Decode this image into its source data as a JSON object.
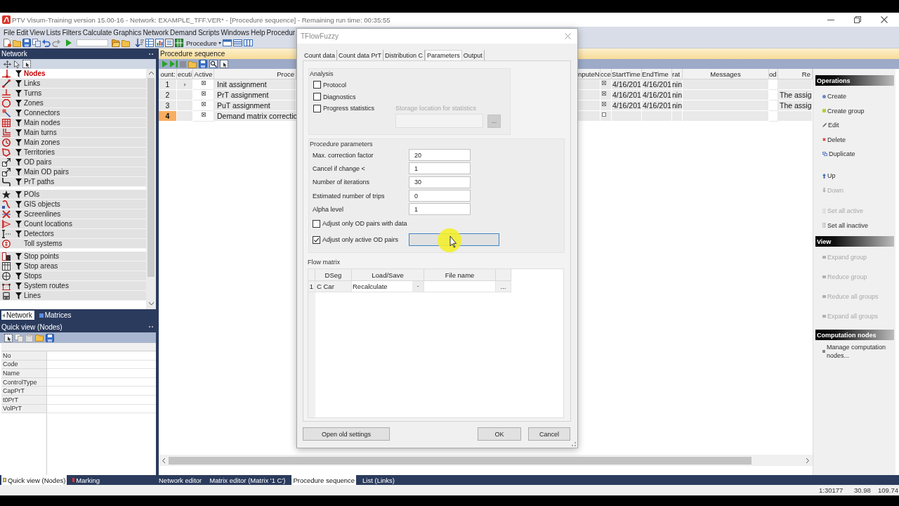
{
  "window": {
    "title": "PTV Visum-Training version 15.00-16 - Network: EXAMPLE_TFF.VER* - [Procedure sequence] - Remaining run time: 00:35:55"
  },
  "menu": [
    "File",
    "Edit",
    "View",
    "Lists",
    "Filters",
    "Calculate",
    "Graphics",
    "Network",
    "Demand",
    "Scripts",
    "Windows",
    "Help",
    "Procedur"
  ],
  "toolbar": {
    "dropdown": "Procedure"
  },
  "network_panel": {
    "title": "Network",
    "groups": [
      [
        {
          "label": "Nodes",
          "selected": true,
          "filter": true
        },
        {
          "label": "Links",
          "selected": false,
          "filter": true
        },
        {
          "label": "Turns",
          "selected": false,
          "filter": true
        },
        {
          "label": "Zones",
          "selected": false,
          "filter": true
        },
        {
          "label": "Connectors",
          "selected": false,
          "filter": true
        },
        {
          "label": "Main nodes",
          "selected": false,
          "filter": true
        },
        {
          "label": "Main turns",
          "selected": false,
          "filter": true
        },
        {
          "label": "Main zones",
          "selected": false,
          "filter": true
        },
        {
          "label": "Territories",
          "selected": false,
          "filter": true
        },
        {
          "label": "OD pairs",
          "selected": false,
          "filter": true
        },
        {
          "label": "Main OD pairs",
          "selected": false,
          "filter": true
        },
        {
          "label": "PrT paths",
          "selected": false,
          "filter": true
        }
      ],
      [
        {
          "label": "POIs",
          "selected": false,
          "filter": true
        },
        {
          "label": "GIS objects",
          "selected": false,
          "filter": true
        },
        {
          "label": "Screenlines",
          "selected": false,
          "filter": true
        },
        {
          "label": "Count locations",
          "selected": false,
          "filter": true
        },
        {
          "label": "Detectors",
          "selected": false,
          "filter": true
        },
        {
          "label": "Toll systems",
          "selected": false,
          "filter": false
        }
      ],
      [
        {
          "label": "Stop points",
          "selected": false,
          "filter": true
        },
        {
          "label": "Stop areas",
          "selected": false,
          "filter": true
        },
        {
          "label": "Stops",
          "selected": false,
          "filter": true
        },
        {
          "label": "System routes",
          "selected": false,
          "filter": true
        },
        {
          "label": "Lines",
          "selected": false,
          "filter": true
        }
      ]
    ]
  },
  "left_tabs": [
    {
      "label": "Network",
      "selected": true
    },
    {
      "label": "Matrices",
      "selected": false
    }
  ],
  "quick_view": {
    "title": "Quick view (Nodes)",
    "rows": [
      "No",
      "Code",
      "Name",
      "ControlType",
      "CapPrT",
      "t0PrT",
      "VolPrT"
    ]
  },
  "procedure_sequence": {
    "title": "Procedure sequence",
    "columns": [
      "ount:",
      "ecuti",
      "Active",
      "Proce",
      "nputeN",
      "cce",
      "StartTime",
      "EndTime",
      "rat",
      "Messages",
      "od",
      "Re"
    ],
    "rows": [
      {
        "column_1": "1",
        "selected": false,
        "current": true,
        "active": true,
        "column_4": "Init assignment",
        "column_6": true,
        "start_time": "4/16/201",
        "end_time": "4/16/201",
        "column_9": "nin"
      },
      {
        "column_1": "2",
        "selected": false,
        "current": false,
        "active": true,
        "column_4": "PrT assignment",
        "column_6": true,
        "start_time": "4/16/201",
        "end_time": "4/16/201",
        "column_9": "nin",
        "column_12": "The assig"
      },
      {
        "column_1": "3",
        "selected": false,
        "current": false,
        "active": true,
        "column_4": "PuT assignment",
        "column_6": true,
        "start_time": "4/16/201",
        "end_time": "4/16/201",
        "column_9": "nin",
        "column_12": "The assig"
      },
      {
        "column_1": "4",
        "selected": true,
        "current": false,
        "active": true,
        "column_4": "Demand matrix correctio",
        "column_6": false
      }
    ]
  },
  "operations": {
    "sections": [
      {
        "title": "Operations",
        "groups": [
          [
            {
              "label": "Create",
              "disabled": false
            },
            {
              "label": "Create group",
              "disabled": false
            },
            {
              "label": "Edit",
              "disabled": false
            },
            {
              "label": "Delete",
              "disabled": false
            },
            {
              "label": "Duplicate",
              "disabled": false
            }
          ],
          [
            {
              "label": "Up",
              "disabled": false
            },
            {
              "label": "Down",
              "disabled": true
            }
          ],
          [
            {
              "label": "Set all active",
              "disabled": true
            },
            {
              "label": "Set all inactive",
              "disabled": false
            }
          ]
        ]
      },
      {
        "title": "View",
        "groups": [
          [
            {
              "label": "Expand group",
              "disabled": true
            },
            {
              "label": "Reduce group",
              "disabled": true
            },
            {
              "label": "Reduce all groups",
              "disabled": true
            },
            {
              "label": "Expand all groups",
              "disabled": true
            }
          ]
        ]
      },
      {
        "title": "Computation nodes",
        "groups": [
          [
            {
              "label": "Manage computation nodes...",
              "disabled": false
            }
          ]
        ]
      }
    ]
  },
  "dialog": {
    "title": "TFlowFuzzy",
    "tabs": [
      {
        "label": "Count data",
        "selected": false
      },
      {
        "label": "Count data PrT",
        "selected": false
      },
      {
        "label": "Distribution C",
        "selected": false
      },
      {
        "label": "Parameters",
        "selected": true
      },
      {
        "label": "Output",
        "selected": false
      }
    ],
    "analysis": {
      "title": "Analysis",
      "options": [
        {
          "label": "Protocol",
          "checked": false
        },
        {
          "label": "Diagnostics",
          "checked": false
        },
        {
          "label": "Progress statistics",
          "checked": false
        }
      ],
      "storage": {
        "label": "Storage location for statistics",
        "disabled": true,
        "button": "..."
      }
    },
    "parameters": {
      "title": "Procedure parameters",
      "fields": [
        {
          "label": "Max. correction factor",
          "value": "20"
        },
        {
          "label": "Cancel if change <",
          "value": "1"
        },
        {
          "label": "Number of iterations",
          "value": "30"
        },
        {
          "label": "Estimated number of trips",
          "value": "0"
        },
        {
          "label": "Alpha level",
          "value": "1"
        }
      ],
      "options": [
        {
          "label": "Adjust only OD pairs with data",
          "checked": false
        },
        {
          "label": "Adjust only active OD pairs",
          "checked": true
        }
      ]
    },
    "flow_matrix": {
      "title": "Flow matrix",
      "columns": [
        "DSeg",
        "Load/Save",
        "File name"
      ],
      "rows": [
        {
          "number": "1",
          "dseg": "C Car",
          "load_save": "Recalculate",
          "button": "..."
        }
      ]
    },
    "buttons": [
      "Open old settings",
      "OK",
      "Cancel"
    ]
  },
  "bottom_tabs": {
    "panels": [
      {
        "label": "Quick view (Nodes)",
        "selected": true
      },
      {
        "label": "Marking",
        "selected": false
      }
    ],
    "documents": [
      {
        "label": "Network editor",
        "selected": false
      },
      {
        "label": "Matrix editor (Matrix '1 C')",
        "selected": false
      },
      {
        "label": "Procedure sequence",
        "selected": true
      },
      {
        "label": "List (Links)",
        "selected": false
      }
    ]
  },
  "status_bar": [
    "1:30177",
    "30.98",
    "109.74"
  ]
}
